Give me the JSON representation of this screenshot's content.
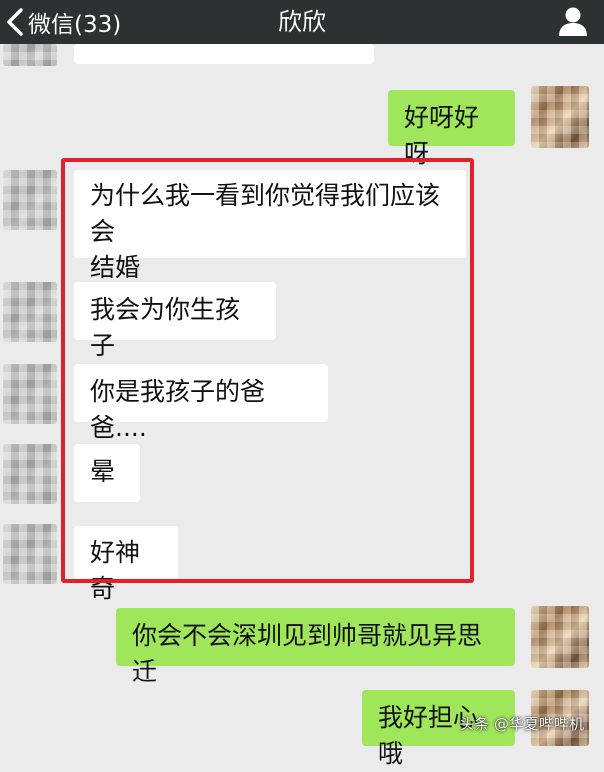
{
  "header": {
    "back_label": "微信(33)",
    "title": "欣欣"
  },
  "messages": [
    {
      "from": "self",
      "text": "好呀好呀"
    },
    {
      "from": "friend",
      "text_lines": [
        "为什么我一看到你觉得我们应该会",
        "结婚"
      ]
    },
    {
      "from": "friend",
      "text": "我会为你生孩子"
    },
    {
      "from": "friend",
      "text": "你是我孩子的爸爸...."
    },
    {
      "from": "friend",
      "text": "晕"
    },
    {
      "from": "friend",
      "text": "好神奇"
    },
    {
      "from": "self",
      "text": "你会不会深圳见到帅哥就见异思迁"
    },
    {
      "from": "self",
      "text": "我好担心哦"
    }
  ],
  "watermark": "头条 @华夏哔哔机",
  "colors": {
    "header_bg": "#2e3132",
    "incoming_bubble": "#ffffff",
    "outgoing_bubble": "#9fe65a",
    "highlight_border": "#e0202d",
    "background": "#ebebeb"
  }
}
